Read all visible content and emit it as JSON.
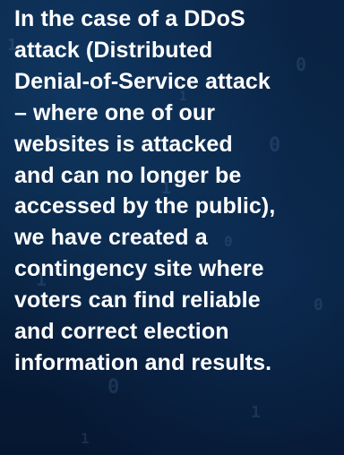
{
  "message": {
    "text": "In the case of a DDoS\nattack (Distributed\nDenial-of-Service attack\n– where one of our\nwebsites is attacked\nand can no longer be\naccessed by the public),\nwe have created a\ncontingency site where\nvoters can find reliable\nand correct election\ninformation and results."
  },
  "colors": {
    "background": "#071a33",
    "text": "#ffffff",
    "accent_glyphs": "#78aadc"
  }
}
